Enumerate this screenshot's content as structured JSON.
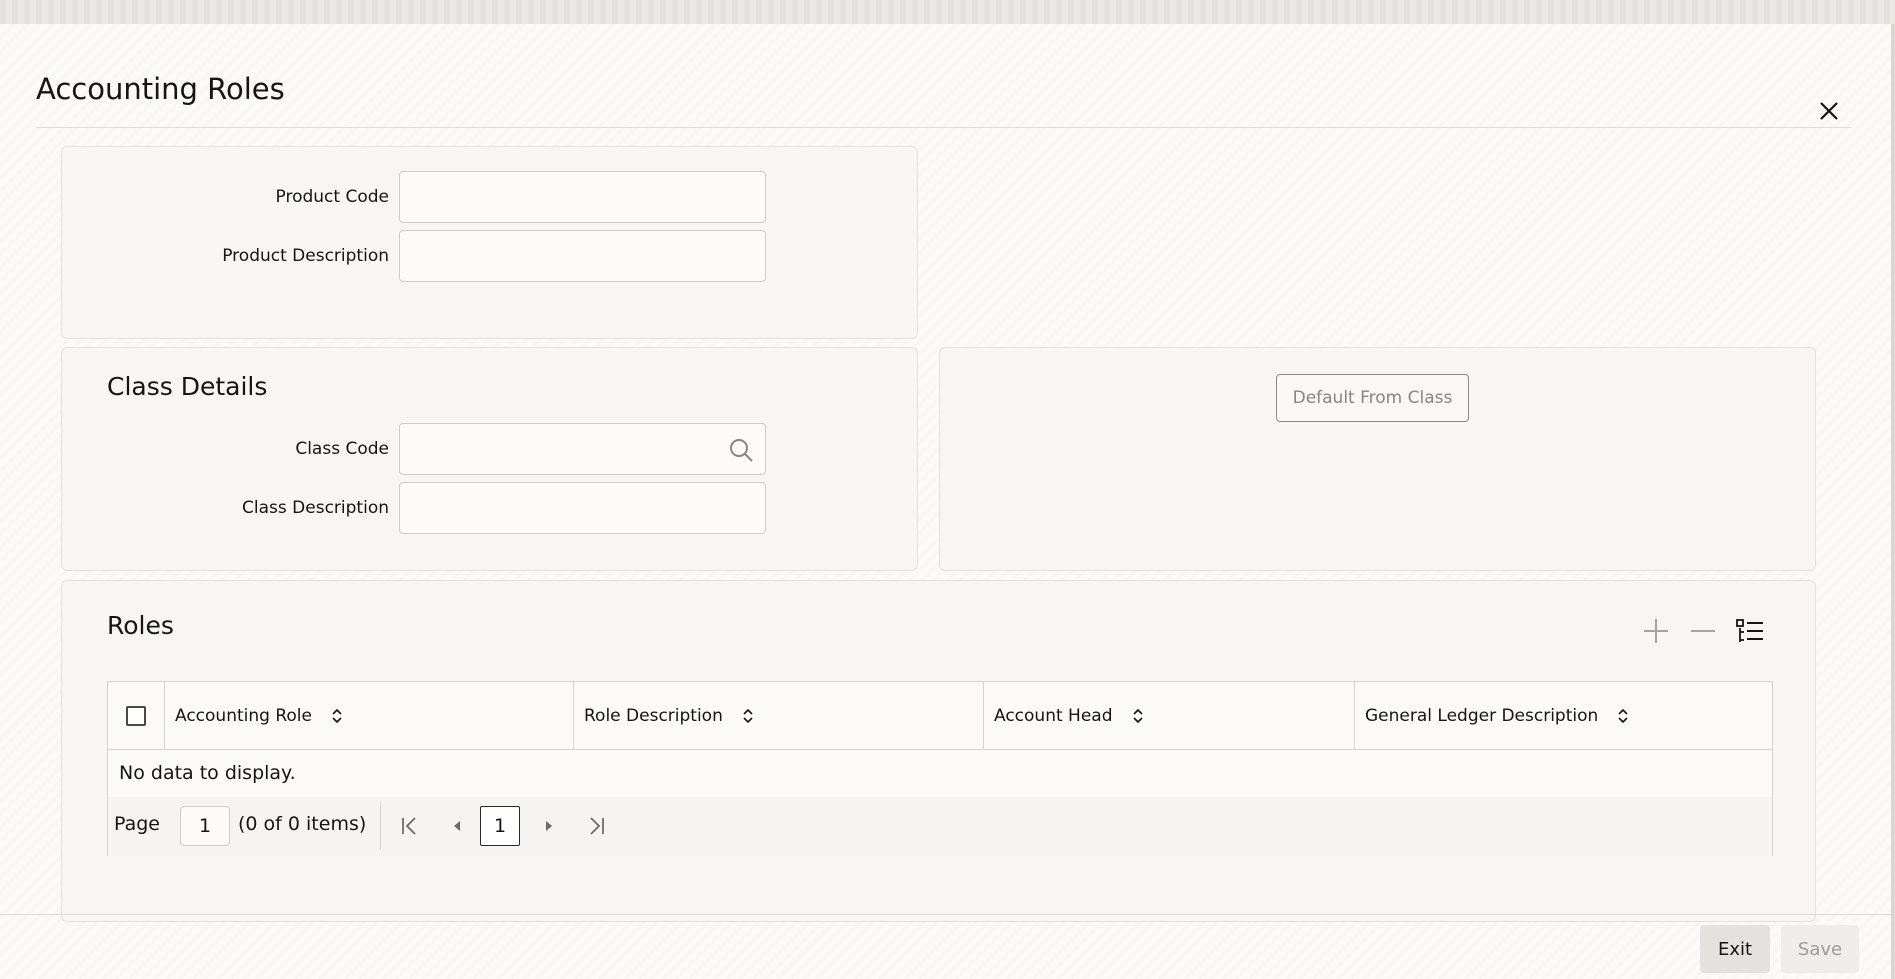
{
  "dialog": {
    "title": "Accounting Roles",
    "close_icon": "close-icon"
  },
  "product": {
    "code_label": "Product Code",
    "code_value": "",
    "description_label": "Product Description",
    "description_value": ""
  },
  "class_details": {
    "title": "Class Details",
    "code_label": "Class Code",
    "code_value": "",
    "description_label": "Class Description",
    "description_value": "",
    "search_icon": "search-icon",
    "default_button": "Default From Class"
  },
  "roles": {
    "title": "Roles",
    "toolbar": {
      "add_icon": "plus-icon",
      "remove_icon": "minus-icon",
      "columns_icon": "list-icon"
    },
    "columns": [
      "Accounting Role",
      "Role Description",
      "Account Head",
      "General Ledger Description"
    ],
    "empty_text": "No data to display.",
    "pager": {
      "page_label": "Page",
      "page_input": "1",
      "items_text": "(0 of 0 items)",
      "current_page": "1"
    }
  },
  "footer": {
    "exit_label": "Exit",
    "save_label": "Save"
  }
}
